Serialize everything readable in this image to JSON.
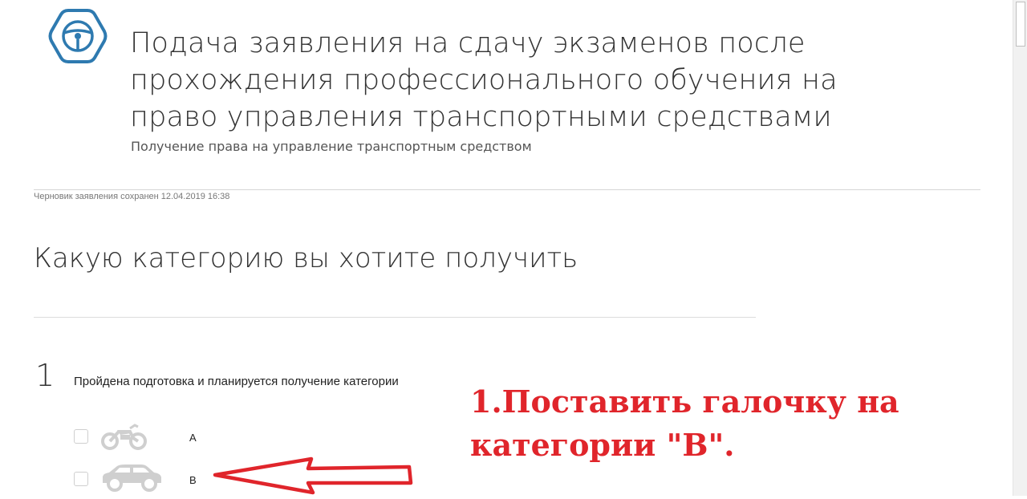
{
  "header": {
    "logo_icon": "steering-wheel-icon",
    "title": "Подача заявления на сдачу экзаменов после прохождения профессионального обучения на право управления транспортными средствами",
    "subtitle": "Получение права на управление транспортным средством"
  },
  "draft_status": "Черновик заявления сохранен 12.04.2019 16:38",
  "question": "Какую категорию вы хотите получить",
  "step": {
    "number": "1",
    "text": "Пройдена подготовка и планируется получение категории",
    "categories": [
      {
        "label": "A",
        "icon": "motorcycle-icon",
        "checked": false
      },
      {
        "label": "B",
        "icon": "car-icon",
        "checked": false
      }
    ]
  },
  "annotation": {
    "text": "1.Поставить галочку на категории \"B\".",
    "color": "#e0252b"
  },
  "colors": {
    "brand": "#2e7ab0",
    "annotation": "#e0252b"
  }
}
